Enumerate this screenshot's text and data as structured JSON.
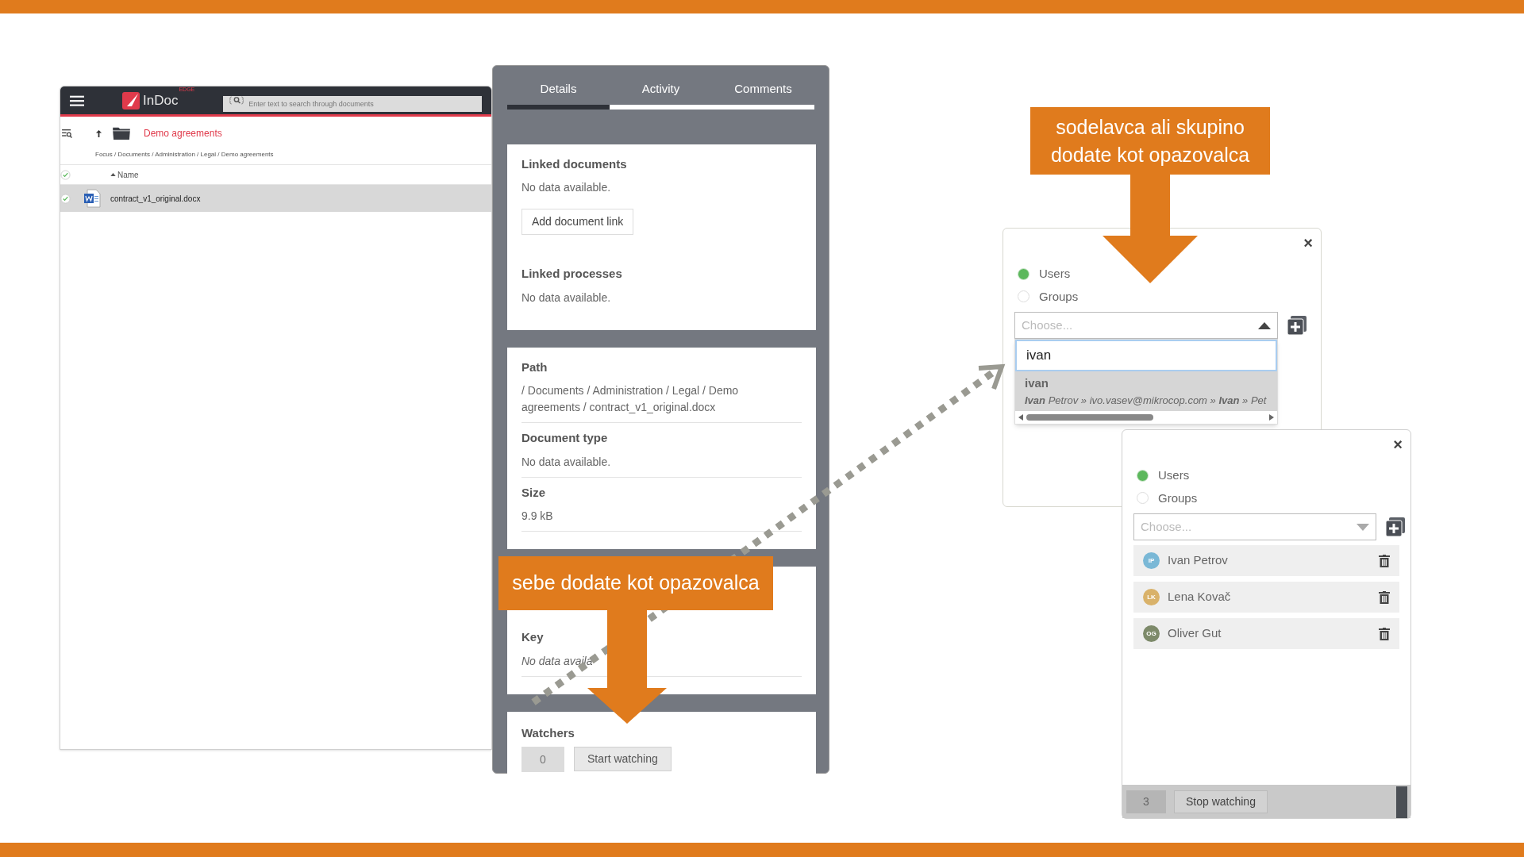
{
  "app": {
    "brand": "InDoc",
    "brand_sup": "EDGE",
    "search": {
      "placeholder": "Enter text to search through documents"
    },
    "folder_title": "Demo agreements",
    "breadcrumb": "Focus / Documents / Administration / Legal / Demo agreements",
    "all_checked": true,
    "columns": [
      "Name"
    ],
    "rows": [
      {
        "name": "contract_v1_original.docx",
        "selected": true,
        "checked": true
      }
    ]
  },
  "details": {
    "tabs": [
      {
        "label": "Details",
        "selected": true
      },
      {
        "label": "Activity",
        "selected": false
      },
      {
        "label": "Comments",
        "selected": false
      }
    ],
    "cards": [
      {
        "kind": "links",
        "sections": [
          {
            "title": "Linked documents",
            "value": "No data available.",
            "button": "Add document link"
          },
          {
            "title": "Linked processes",
            "value": "No data available."
          }
        ]
      },
      {
        "kind": "fields",
        "sections": [
          {
            "title": "Path",
            "value": "/ Documents / Administration / Legal / Demo agreements / contract_v1_original.docx"
          },
          {
            "title": "Document type",
            "value": "No data available."
          },
          {
            "title": "Size",
            "value": "9.9 kB"
          }
        ]
      },
      {
        "kind": "fields",
        "sections": [
          {
            "title": "Key",
            "value": "No data availa",
            "italic": true
          }
        ]
      },
      {
        "kind": "watchers",
        "title": "Watchers",
        "count": "0",
        "button": "Start watching"
      }
    ]
  },
  "callouts": [
    {
      "text": "sodelavca ali skupino dodate kot opazovalca"
    },
    {
      "text": "sebe dodate kot opazovalca"
    }
  ],
  "dialog_search": {
    "close": "×",
    "options": [
      {
        "label": "Users",
        "selected": true
      },
      {
        "label": "Groups",
        "selected": false
      }
    ],
    "select": {
      "placeholder": "Choose...",
      "expanded": true
    },
    "search": {
      "value": "ivan"
    },
    "result": {
      "title": "ivan",
      "detail": "**Ivan** Petrov » ivo.vasev@mikrocop.com » **Ivan** » Pet"
    }
  },
  "dialog_watchers": {
    "close": "×",
    "options": [
      {
        "label": "Users",
        "selected": true
      },
      {
        "label": "Groups",
        "selected": false
      }
    ],
    "select": {
      "placeholder": "Choose...",
      "expanded": false
    },
    "watchers": [
      {
        "initials": "IP",
        "name": "Ivan Petrov",
        "color": "#7ab8d6"
      },
      {
        "initials": "LK",
        "name": "Lena Kovač",
        "color": "#d9b26a"
      },
      {
        "initials": "OG",
        "name": "Oliver Gut",
        "color": "#7d8a6a"
      }
    ],
    "count": "3",
    "button": "Stop watching"
  }
}
